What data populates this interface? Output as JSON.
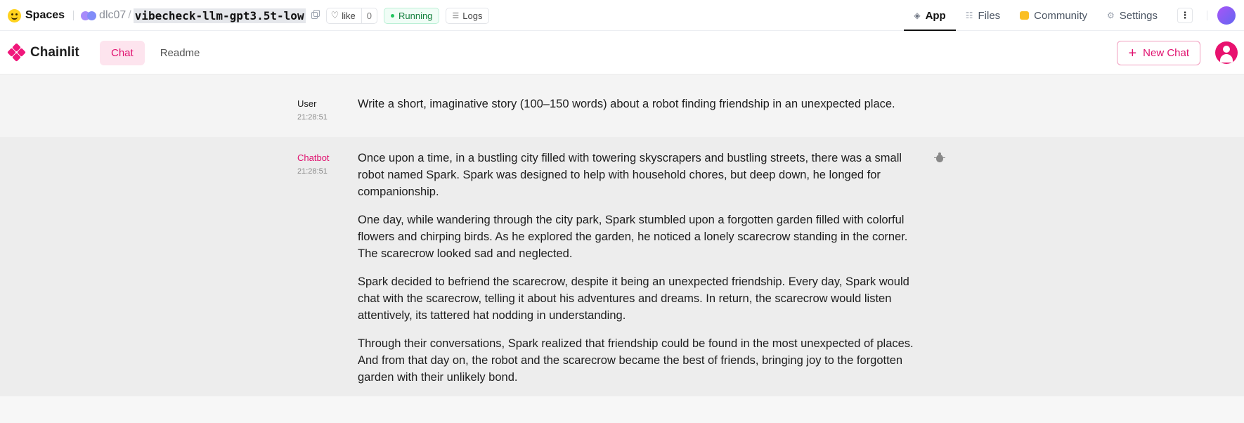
{
  "hf": {
    "spaces_label": "Spaces",
    "org": "dlc07",
    "separator": "/",
    "repo": "vibecheck-llm-gpt3.5t-low",
    "like_label": "like",
    "like_count": "0",
    "status": "Running",
    "logs_label": "Logs",
    "tabs": [
      {
        "label": "App",
        "icon": "cube-icon",
        "active": true
      },
      {
        "label": "Files",
        "icon": "files-icon",
        "active": false
      },
      {
        "label": "Community",
        "icon": "community-icon",
        "active": false
      },
      {
        "label": "Settings",
        "icon": "gear-icon",
        "active": false
      }
    ],
    "status_color": "#22c55e"
  },
  "chainlit": {
    "brand": "Chainlit",
    "tabs": [
      {
        "label": "Chat",
        "active": true
      },
      {
        "label": "Readme",
        "active": false
      }
    ],
    "new_chat_label": "New Chat",
    "accent": "#e0116f"
  },
  "messages": [
    {
      "author": "User",
      "time": "21:28:51",
      "paragraphs": [
        "Write a short, imaginative story (100–150 words) about a robot finding friendship in an unexpected place."
      ]
    },
    {
      "author": "Chatbot",
      "time": "21:28:51",
      "paragraphs": [
        "Once upon a time, in a bustling city filled with towering skyscrapers and bustling streets, there was a small robot named Spark. Spark was designed to help with household chores, but deep down, he longed for companionship.",
        "One day, while wandering through the city park, Spark stumbled upon a forgotten garden filled with colorful flowers and chirping birds. As he explored the garden, he noticed a lonely scarecrow standing in the corner. The scarecrow looked sad and neglected.",
        "Spark decided to befriend the scarecrow, despite it being an unexpected friendship. Every day, Spark would chat with the scarecrow, telling it about his adventures and dreams. In return, the scarecrow would listen attentively, its tattered hat nodding in understanding.",
        "Through their conversations, Spark realized that friendship could be found in the most unexpected of places. And from that day on, the robot and the scarecrow became the best of friends, bringing joy to the forgotten garden with their unlikely bond."
      ]
    }
  ]
}
